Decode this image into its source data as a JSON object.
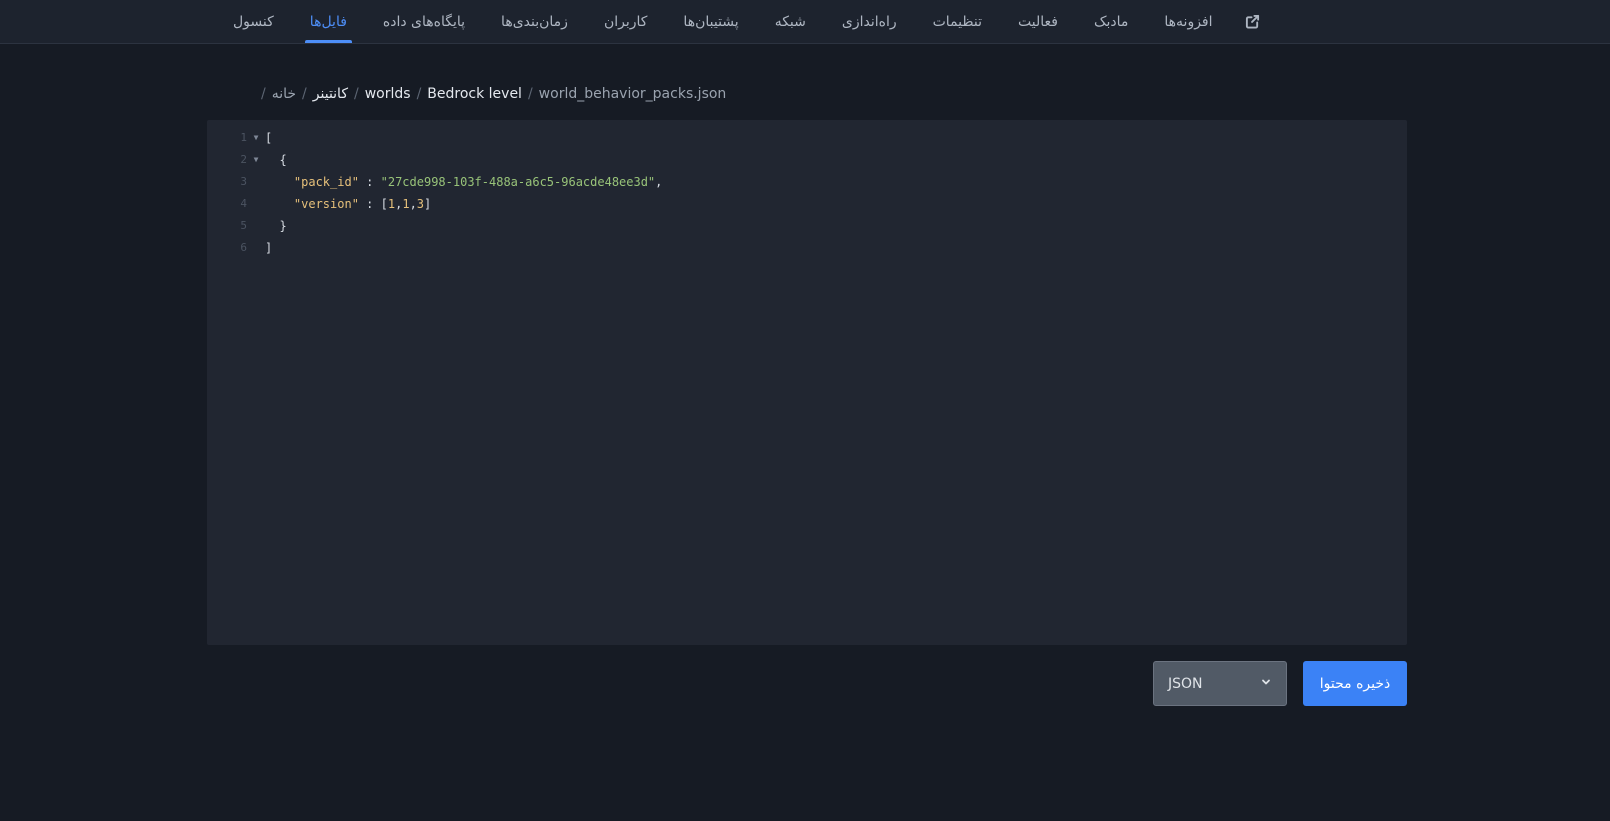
{
  "nav": {
    "items": [
      {
        "label": "کنسول"
      },
      {
        "label": "فایل‌ها"
      },
      {
        "label": "پایگاه‌های داده"
      },
      {
        "label": "زمان‌بندی‌ها"
      },
      {
        "label": "کاربران"
      },
      {
        "label": "پشتیبان‌ها"
      },
      {
        "label": "شبکه"
      },
      {
        "label": "راه‌اندازی"
      },
      {
        "label": "تنظیمات"
      },
      {
        "label": "فعالیت"
      },
      {
        "label": "مادبک"
      },
      {
        "label": "افزونه‌ها"
      }
    ],
    "active_index": 1,
    "external_icon": "external-link-icon"
  },
  "breadcrumb": {
    "leading_sep": "/",
    "home": "خانه",
    "items": [
      "کانتینر",
      "worlds",
      "Bedrock level"
    ],
    "current": "world_behavior_packs.json",
    "sep": "/"
  },
  "editor": {
    "line_numbers": [
      "1",
      "2",
      "3",
      "4",
      "5",
      "6"
    ],
    "lines": {
      "l1": "[",
      "l2": "  {",
      "l3_key": "\"pack_id\"",
      "l3_colon": " : ",
      "l3_val": "\"27cde998-103f-488a-a6c5-96acde48ee3d\"",
      "l3_comma": ",",
      "l4_key": "\"version\"",
      "l4_colon": " : ",
      "l4_open": "[",
      "l4_n1": "1",
      "l4_c1": ",",
      "l4_n2": "1",
      "l4_c2": ",",
      "l4_n3": "3",
      "l4_close": "]",
      "l5": "  }",
      "l6": "]"
    }
  },
  "controls": {
    "language_value": "JSON",
    "save_label": "ذخیره محتوا"
  },
  "colors": {
    "accent": "#3b82f6",
    "active_tab": "#4d8ef7",
    "background": "#161b24",
    "editor_bg": "#212631"
  }
}
